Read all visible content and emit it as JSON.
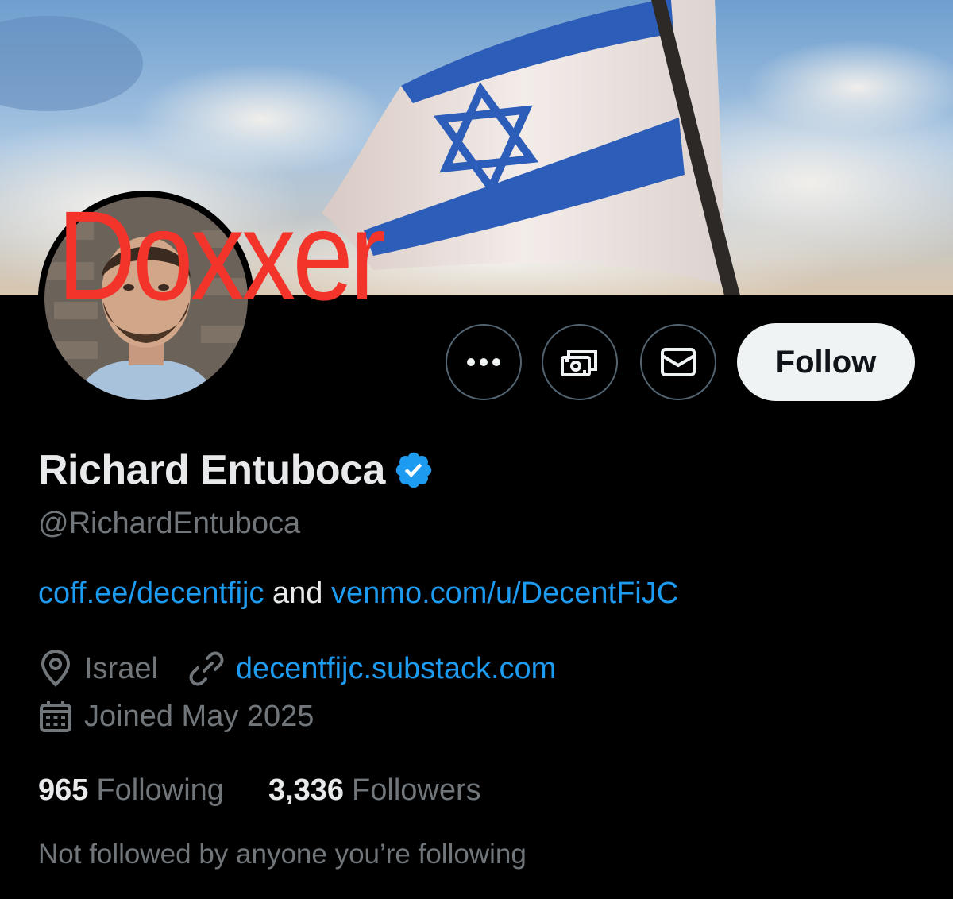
{
  "overlay": {
    "text": "Doxxer"
  },
  "actions": {
    "more_icon": "more-horizontal-icon",
    "tip_icon": "money-tip-icon",
    "message_icon": "envelope-icon",
    "follow_label": "Follow"
  },
  "profile": {
    "display_name": "Richard Entuboca",
    "verified": true,
    "handle": "@RichardEntuboca",
    "bio": {
      "link1": "coff.ee/decentfijc",
      "connector": " and ",
      "link2": "venmo.com/u/DecentFiJC"
    },
    "location": "Israel",
    "website": "decentfijc.substack.com",
    "joined": "Joined May 2025"
  },
  "stats": {
    "following_count": "965",
    "following_label": "Following",
    "followers_count": "3,336",
    "followers_label": "Followers"
  },
  "followed_by_note": "Not followed by anyone you’re following",
  "colors": {
    "background": "#000000",
    "link": "#1d9bf0",
    "secondary_text": "#71767b",
    "primary_text": "#e7e9ea",
    "overlay_red": "#f2342b",
    "verified_blue": "#1d9bf0"
  }
}
